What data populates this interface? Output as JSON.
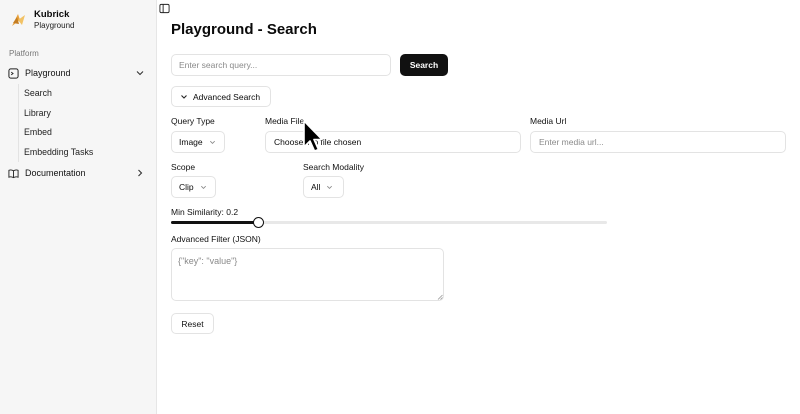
{
  "brand": {
    "name": "Kubrick",
    "subtitle": "Playground"
  },
  "sidebar": {
    "section_label": "Platform",
    "playground": {
      "label": "Playground",
      "items": [
        {
          "label": "Search"
        },
        {
          "label": "Library"
        },
        {
          "label": "Embed"
        },
        {
          "label": "Embedding Tasks"
        }
      ]
    },
    "documentation": {
      "label": "Documentation"
    }
  },
  "page": {
    "title": "Playground - Search"
  },
  "search": {
    "placeholder": "Enter search query...",
    "value": "",
    "button_label": "Search"
  },
  "advanced": {
    "toggle_label": "Advanced Search",
    "query_type": {
      "label": "Query Type",
      "value": "Image"
    },
    "media_file": {
      "label": "Media File",
      "choose_label": "Choose",
      "status": "No file chosen"
    },
    "media_url": {
      "label": "Media Url",
      "placeholder": "Enter media url..."
    },
    "scope": {
      "label": "Scope",
      "value": "Clip"
    },
    "search_modality": {
      "label": "Search Modality",
      "value": "All"
    },
    "min_similarity": {
      "label": "Min Similarity: 0.2",
      "value": 0.2
    },
    "filter": {
      "label": "Advanced Filter (JSON)",
      "placeholder": "{\"key\": \"value\"}"
    },
    "reset_label": "Reset"
  },
  "icons": {
    "logo": "kubrick-logo-icon",
    "sidebar_toggle": "sidebar-toggle-icon",
    "playground": "square-terminal-icon",
    "documentation": "book-open-icon",
    "cursor": "mouse-pointer-icon"
  },
  "colors": {
    "accent": "#111111",
    "logo": "#e9a23b"
  }
}
